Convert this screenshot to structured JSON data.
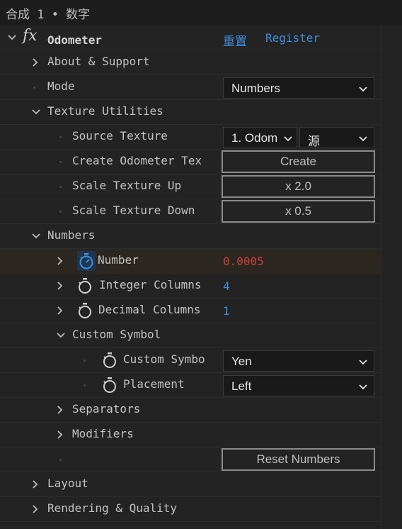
{
  "header": {
    "title": "合成 1 • 数字"
  },
  "effect": {
    "name": "Odometer",
    "fx_label": "fx",
    "reset_label": "重置",
    "register_label": "Register"
  },
  "rows": {
    "about": "About & Support",
    "mode_label": "Mode",
    "mode_value": "Numbers",
    "texture_utilities": "Texture Utilities",
    "source_texture_label": "Source Texture",
    "source_texture_value": "1. Odom",
    "source_texture_channel": "源",
    "create_tex_label": "Create Odometer Tex",
    "create_button": "Create",
    "scale_up_label": "Scale Texture Up",
    "scale_up_button": "x 2.0",
    "scale_down_label": "Scale Texture Down",
    "scale_down_button": "x 0.5",
    "numbers": "Numbers",
    "number_label": "Number",
    "number_value": "0.0005",
    "integer_columns_label": "Integer Columns",
    "integer_columns_value": "4",
    "decimal_columns_label": "Decimal Columns",
    "decimal_columns_value": "1",
    "custom_symbol": "Custom Symbol",
    "custom_symbol_label": "Custom Symbo",
    "custom_symbol_value": "Yen",
    "placement_label": "Placement",
    "placement_value": "Left",
    "separators": "Separators",
    "modifiers": "Modifiers",
    "reset_numbers_button": "Reset Numbers",
    "layout": "Layout",
    "rendering_quality": "Rendering & Quality"
  },
  "colors": {
    "accent_link": "#3f8fdc",
    "number_value": "#d0403a",
    "stopwatch_active": "#3f8fdc"
  }
}
